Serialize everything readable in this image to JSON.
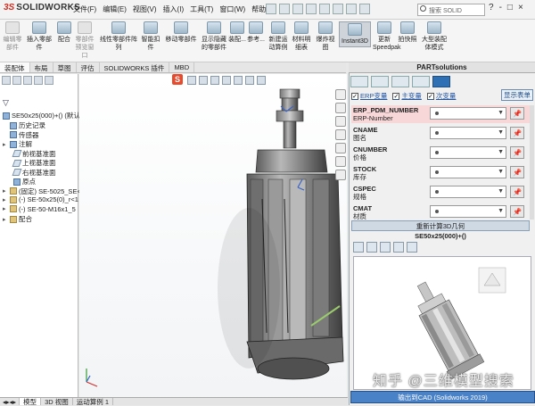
{
  "app": {
    "logo_ds": "3S",
    "logo_name": "SOLIDWORKS",
    "menu": [
      "文件(F)",
      "编辑(E)",
      "视图(V)",
      "插入(I)",
      "工具(T)",
      "窗口(W)",
      "帮助(H)"
    ],
    "search_placeholder": "搜索 SOLID",
    "window_buttons": [
      "?",
      "-",
      "□",
      "×"
    ]
  },
  "commands": [
    {
      "label": "编辑零部件",
      "dim": true
    },
    {
      "label": "插入零部件",
      "dim": false
    },
    {
      "label": "配合",
      "dim": false
    },
    {
      "label": "零部件预览窗口",
      "dim": true
    },
    {
      "label": "线性零部件阵列",
      "dim": false
    },
    {
      "label": "智能扣件",
      "dim": false
    },
    {
      "label": "移动零部件",
      "dim": false
    },
    {
      "label": "显示隐藏的零部件",
      "dim": false
    },
    {
      "label": "装配...",
      "dim": false
    },
    {
      "label": "参考...",
      "dim": false
    },
    {
      "label": "新建运动算例",
      "dim": false
    },
    {
      "label": "材料明细表",
      "dim": false
    },
    {
      "label": "爆炸视图",
      "dim": false
    },
    {
      "label": "Instant3D",
      "dim": false,
      "active": true
    },
    {
      "label": "更新Speedpak",
      "dim": false
    },
    {
      "label": "拍快照",
      "dim": false
    },
    {
      "label": "大型装配体模式",
      "dim": false
    }
  ],
  "cmd_tabs": [
    {
      "label": "装配体",
      "active": true
    },
    {
      "label": "布局"
    },
    {
      "label": "草图"
    },
    {
      "label": "评估"
    },
    {
      "label": "SOLIDWORKS 插件"
    },
    {
      "label": "MBD"
    }
  ],
  "tree": {
    "root": "SE50x25(000)+() (默认",
    "items": [
      {
        "label": "历史记录",
        "icon": "history-icon",
        "indent": 1
      },
      {
        "label": "传感器",
        "icon": "sensor-icon",
        "indent": 1
      },
      {
        "label": "注解",
        "icon": "annotation-icon",
        "indent": 1,
        "arrow": true
      },
      {
        "label": "前视基准面",
        "icon": "plane-icon",
        "indent": 2
      },
      {
        "label": "上视基准面",
        "icon": "plane-icon",
        "indent": 2
      },
      {
        "label": "右视基准面",
        "icon": "plane-icon",
        "indent": 2
      },
      {
        "label": "原点",
        "icon": "origin-icon",
        "indent": 2
      },
      {
        "label": "(固定) SE-5025_SE<",
        "icon": "part-icon",
        "indent": 1,
        "arrow": true
      },
      {
        "label": "(-) SE-50x25(0)_r<1",
        "icon": "part-icon",
        "indent": 1,
        "arrow": true
      },
      {
        "label": "(-) SE-50-M16x1_5",
        "icon": "part-icon",
        "indent": 1,
        "arrow": true
      },
      {
        "label": "配合",
        "icon": "mates-icon",
        "indent": 1,
        "arrow": true
      }
    ]
  },
  "partsolutions": {
    "title": "PARTsolutions",
    "checks": [
      {
        "label": "ERP变量",
        "checked": true
      },
      {
        "label": "主变量",
        "checked": true
      },
      {
        "label": "次变量",
        "checked": true
      }
    ],
    "show_table": "显示表单",
    "props": [
      {
        "name": "ERP_PDM_NUMBER",
        "sub": "ERP-Number",
        "highlight": true
      },
      {
        "name": "CNAME",
        "sub": "图名"
      },
      {
        "name": "CNUMBER",
        "sub": "价格"
      },
      {
        "name": "STOCK",
        "sub": "库存"
      },
      {
        "name": "CSPEC",
        "sub": "规格"
      },
      {
        "name": "CMAT",
        "sub": "材质"
      }
    ],
    "regen_button": "重新计算3D几何",
    "part_name": "SE50x25(000)+()",
    "export_button": "输出到CAD (Solidworks 2019)",
    "watermark": "知乎 @三维模型搜索"
  },
  "bottom_tabs": [
    {
      "label": "模型",
      "active": true
    },
    {
      "label": "3D 视图"
    },
    {
      "label": "运动算例 1"
    }
  ]
}
